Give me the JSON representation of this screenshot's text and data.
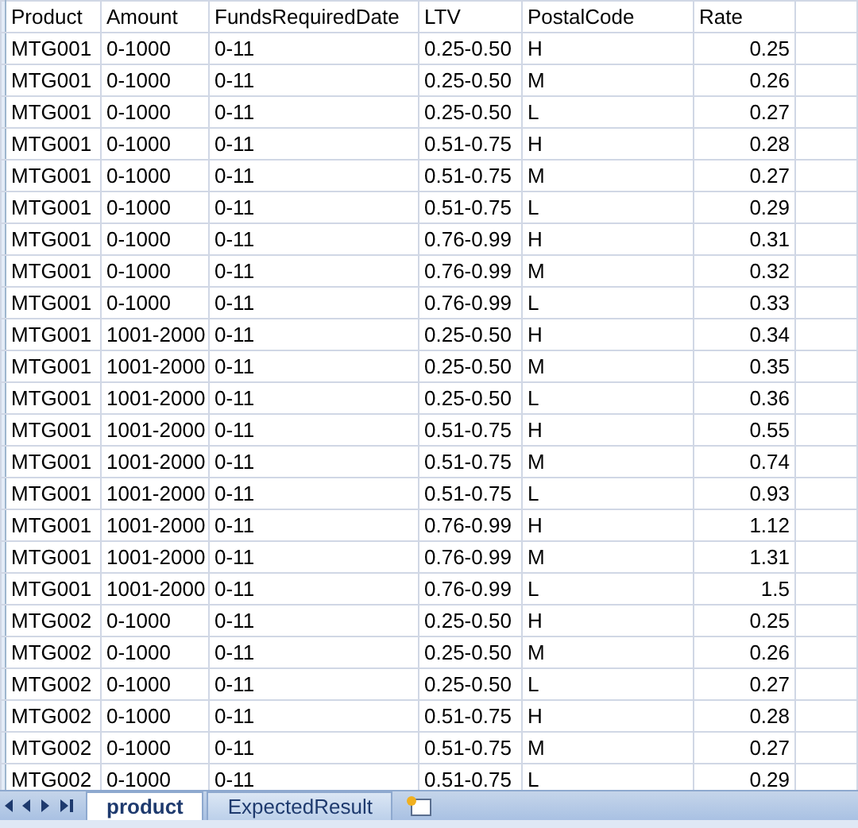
{
  "table": {
    "columns": [
      {
        "label": "Product",
        "kind": "text"
      },
      {
        "label": "Amount",
        "kind": "text"
      },
      {
        "label": "FundsRequiredDate",
        "kind": "text"
      },
      {
        "label": "LTV",
        "kind": "text"
      },
      {
        "label": "PostalCode",
        "kind": "text"
      },
      {
        "label": "Rate",
        "kind": "number"
      }
    ],
    "rows": [
      [
        "MTG001",
        "0-1000",
        "0-11",
        "0.25-0.50",
        "H",
        "0.25"
      ],
      [
        "MTG001",
        "0-1000",
        "0-11",
        "0.25-0.50",
        "M",
        "0.26"
      ],
      [
        "MTG001",
        "0-1000",
        "0-11",
        "0.25-0.50",
        "L",
        "0.27"
      ],
      [
        "MTG001",
        "0-1000",
        "0-11",
        "0.51-0.75",
        "H",
        "0.28"
      ],
      [
        "MTG001",
        "0-1000",
        "0-11",
        "0.51-0.75",
        "M",
        "0.27"
      ],
      [
        "MTG001",
        "0-1000",
        "0-11",
        "0.51-0.75",
        "L",
        "0.29"
      ],
      [
        "MTG001",
        "0-1000",
        "0-11",
        "0.76-0.99",
        "H",
        "0.31"
      ],
      [
        "MTG001",
        "0-1000",
        "0-11",
        "0.76-0.99",
        "M",
        "0.32"
      ],
      [
        "MTG001",
        "0-1000",
        "0-11",
        "0.76-0.99",
        "L",
        "0.33"
      ],
      [
        "MTG001",
        "1001-2000",
        "0-11",
        "0.25-0.50",
        "H",
        "0.34"
      ],
      [
        "MTG001",
        "1001-2000",
        "0-11",
        "0.25-0.50",
        "M",
        "0.35"
      ],
      [
        "MTG001",
        "1001-2000",
        "0-11",
        "0.25-0.50",
        "L",
        "0.36"
      ],
      [
        "MTG001",
        "1001-2000",
        "0-11",
        "0.51-0.75",
        "H",
        "0.55"
      ],
      [
        "MTG001",
        "1001-2000",
        "0-11",
        "0.51-0.75",
        "M",
        "0.74"
      ],
      [
        "MTG001",
        "1001-2000",
        "0-11",
        "0.51-0.75",
        "L",
        "0.93"
      ],
      [
        "MTG001",
        "1001-2000",
        "0-11",
        "0.76-0.99",
        "H",
        "1.12"
      ],
      [
        "MTG001",
        "1001-2000",
        "0-11",
        "0.76-0.99",
        "M",
        "1.31"
      ],
      [
        "MTG001",
        "1001-2000",
        "0-11",
        "0.76-0.99",
        "L",
        "1.5"
      ],
      [
        "MTG002",
        "0-1000",
        "0-11",
        "0.25-0.50",
        "H",
        "0.25"
      ],
      [
        "MTG002",
        "0-1000",
        "0-11",
        "0.25-0.50",
        "M",
        "0.26"
      ],
      [
        "MTG002",
        "0-1000",
        "0-11",
        "0.25-0.50",
        "L",
        "0.27"
      ],
      [
        "MTG002",
        "0-1000",
        "0-11",
        "0.51-0.75",
        "H",
        "0.28"
      ],
      [
        "MTG002",
        "0-1000",
        "0-11",
        "0.51-0.75",
        "M",
        "0.27"
      ],
      [
        "MTG002",
        "0-1000",
        "0-11",
        "0.51-0.75",
        "L",
        "0.29"
      ]
    ]
  },
  "sheet_tabs": [
    {
      "label": "product",
      "selected": true
    },
    {
      "label": "ExpectedResult",
      "selected": false
    }
  ]
}
